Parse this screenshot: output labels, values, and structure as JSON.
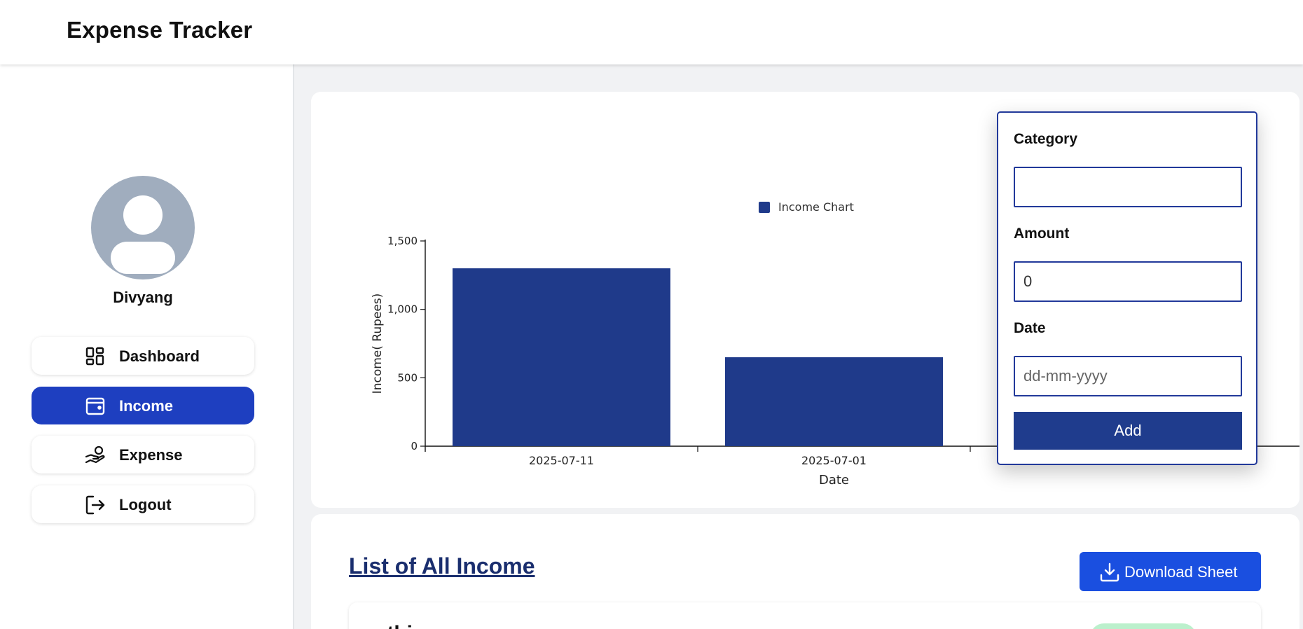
{
  "app": {
    "title": "Expense Tracker"
  },
  "user": {
    "name": "Divyang"
  },
  "sidebar": {
    "items": [
      {
        "label": "Dashboard",
        "icon": "dashboard-icon",
        "active": false
      },
      {
        "label": "Income",
        "icon": "wallet-icon",
        "active": true
      },
      {
        "label": "Expense",
        "icon": "hand-coins-icon",
        "active": false
      },
      {
        "label": "Logout",
        "icon": "logout-icon",
        "active": false
      }
    ]
  },
  "form": {
    "category_label": "Category",
    "category_value": "",
    "amount_label": "Amount",
    "amount_value": "0",
    "date_label": "Date",
    "date_placeholder": "dd-mm-yyyy",
    "add_label": "Add"
  },
  "list": {
    "title": "List of All Income",
    "download_label": "Download Sheet",
    "first_row_title": "othi..."
  },
  "colors": {
    "accent": "#1e3fc0",
    "bar": "#1f3a8a",
    "download": "#1a4fe0",
    "avatar": "#a0adbe"
  },
  "chart_data": {
    "type": "bar",
    "legend": "Income Chart",
    "legend_position": "top-center",
    "categories": [
      "2025-07-11",
      "2025-07-01"
    ],
    "series": [
      {
        "name": "Income Chart",
        "values": [
          1300,
          650
        ]
      }
    ],
    "xlabel": "Date",
    "ylabel": "Income( Rupees)",
    "ylim": [
      0,
      1500
    ],
    "yticks": [
      "0",
      "500",
      "1,000",
      "1,500"
    ],
    "grid": false
  }
}
